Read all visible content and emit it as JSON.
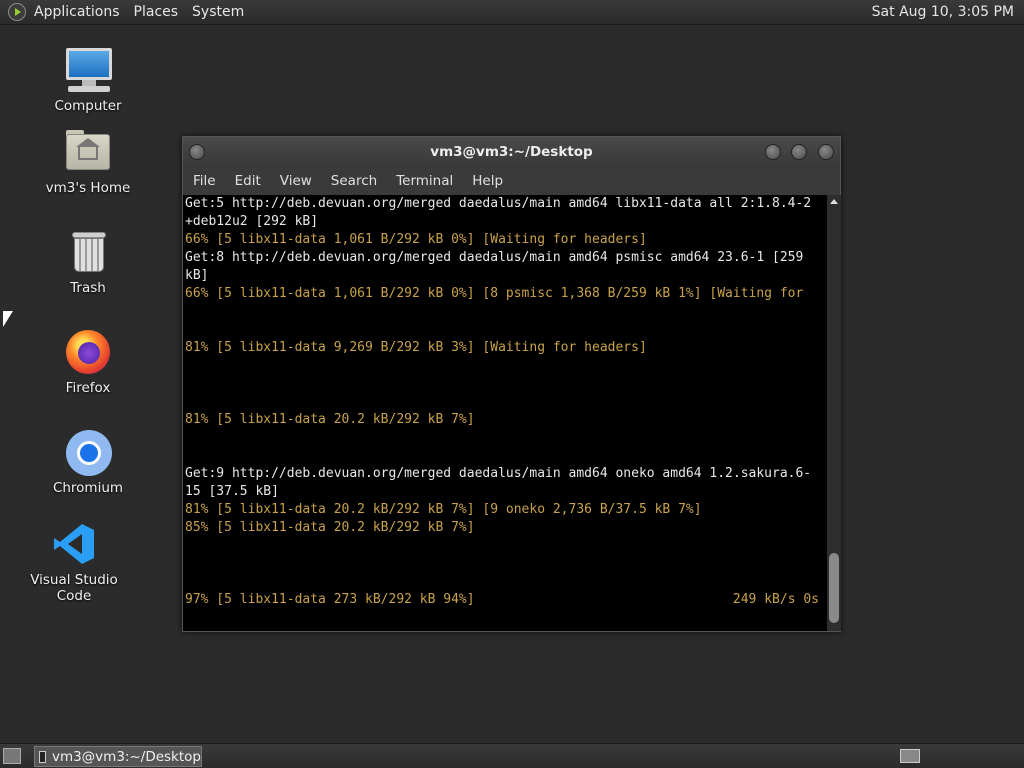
{
  "top_panel": {
    "menus": [
      "Applications",
      "Places",
      "System"
    ],
    "clock": "Sat Aug 10,  3:05 PM"
  },
  "desktop_icons": [
    {
      "label": "Computer",
      "icon": "computer-icon"
    },
    {
      "label": "vm3's Home",
      "icon": "home-folder-icon"
    },
    {
      "label": "Trash",
      "icon": "trash-icon"
    },
    {
      "label": "Firefox",
      "icon": "firefox-icon"
    },
    {
      "label": "Chromium",
      "icon": "chromium-icon"
    },
    {
      "label": "Visual Studio Code",
      "icon": "vscode-icon"
    }
  ],
  "terminal": {
    "title": "vm3@vm3:~/Desktop",
    "menu": [
      "File",
      "Edit",
      "View",
      "Search",
      "Terminal",
      "Help"
    ],
    "lines": [
      {
        "text": "Get:5 http://deb.devuan.org/merged daedalus/main amd64 libx11-data all 2:1.8.4-2",
        "kind": "normal"
      },
      {
        "text": "+deb12u2 [292 kB]",
        "kind": "normal"
      },
      {
        "text": "66% [5 libx11-data 1,061 B/292 kB 0%] [Waiting for headers]",
        "kind": "progress"
      },
      {
        "text": "Get:8 http://deb.devuan.org/merged daedalus/main amd64 psmisc amd64 23.6-1 [259",
        "kind": "normal"
      },
      {
        "text": "kB]",
        "kind": "normal"
      },
      {
        "text": "66% [5 libx11-data 1,061 B/292 kB 0%] [8 psmisc 1,368 B/259 kB 1%] [Waiting for",
        "kind": "progress"
      },
      {
        "text": "",
        "kind": "normal"
      },
      {
        "text": "",
        "kind": "normal"
      },
      {
        "text": "81% [5 libx11-data 9,269 B/292 kB 3%] [Waiting for headers]",
        "kind": "progress"
      },
      {
        "text": "",
        "kind": "normal"
      },
      {
        "text": "",
        "kind": "normal"
      },
      {
        "text": "",
        "kind": "normal"
      },
      {
        "text": "81% [5 libx11-data 20.2 kB/292 kB 7%]",
        "kind": "progress"
      },
      {
        "text": "",
        "kind": "normal"
      },
      {
        "text": "",
        "kind": "normal"
      },
      {
        "text": "Get:9 http://deb.devuan.org/merged daedalus/main amd64 oneko amd64 1.2.sakura.6-",
        "kind": "normal"
      },
      {
        "text": "15 [37.5 kB]",
        "kind": "normal"
      },
      {
        "text": "81% [5 libx11-data 20.2 kB/292 kB 7%] [9 oneko 2,736 B/37.5 kB 7%]",
        "kind": "progress"
      },
      {
        "text": "85% [5 libx11-data 20.2 kB/292 kB 7%]",
        "kind": "progress"
      },
      {
        "text": "",
        "kind": "normal"
      },
      {
        "text": "",
        "kind": "normal"
      },
      {
        "text": "",
        "kind": "normal"
      },
      {
        "text": "97% [5 libx11-data 273 kB/292 kB 94%]",
        "kind": "progress",
        "right": "249 kB/s 0s"
      }
    ]
  },
  "taskbar": {
    "task_label": "vm3@vm3:~/Desktop"
  }
}
